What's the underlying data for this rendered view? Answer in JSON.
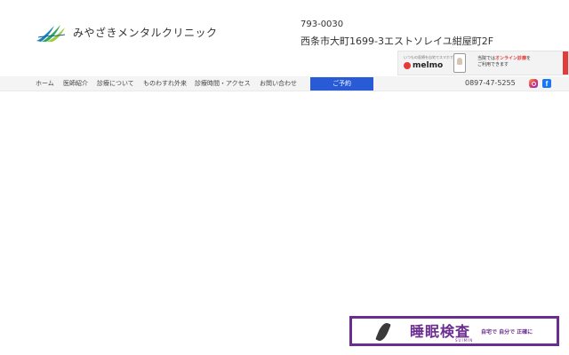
{
  "header": {
    "clinic_name": "みやざきメンタルクリニック",
    "postal_code": "793-0030",
    "address": "西条市大町1699-3エストソレイユ紺屋町2F"
  },
  "melmo_banner": {
    "small_text": "いつもの医療を自宅でスマホで",
    "brand": "melmo",
    "line1_prefix": "当院では",
    "line1_accent": "オンライン診療",
    "line1_suffix": "を",
    "line2": "ご利用できます"
  },
  "nav": {
    "items": [
      "ホーム",
      "医師紹介",
      "診療について",
      "ものわすれ外来",
      "診療時間・アクセス",
      "お問い合わせ"
    ],
    "reserve_label": "ご予約",
    "phone": "0897-47-5255"
  },
  "social": {
    "facebook_glyph": "f"
  },
  "sleep_banner": {
    "title": "睡眠検査",
    "romaji": "SUIMIN",
    "subtitle": "自宅で 自分で 正確に"
  },
  "colors": {
    "reserve_button": "#2a5bd7",
    "banner_purple": "#6b2d8f",
    "melmo_red": "#e23b3b"
  }
}
